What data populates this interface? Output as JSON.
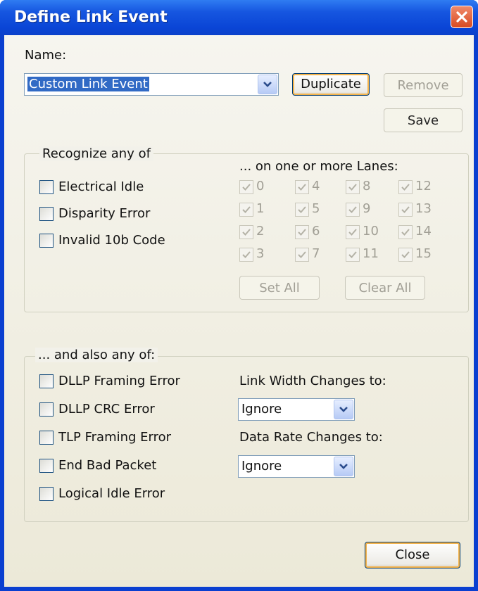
{
  "window": {
    "title": "Define Link Event"
  },
  "name_section": {
    "label": "Name:",
    "selected": "Custom Link Event",
    "duplicate_label": "Duplicate",
    "remove_label": "Remove",
    "save_label": "Save"
  },
  "recognize": {
    "title": "Recognize any of",
    "options": [
      "Electrical Idle",
      "Disparity Error",
      "Invalid 10b Code"
    ],
    "lanes_title": "... on one or more Lanes:",
    "lanes": [
      "0",
      "1",
      "2",
      "3",
      "4",
      "5",
      "6",
      "7",
      "8",
      "9",
      "10",
      "11",
      "12",
      "13",
      "14",
      "15"
    ],
    "set_all_label": "Set All",
    "clear_all_label": "Clear All"
  },
  "also": {
    "title": "... and also any of:",
    "options": [
      "DLLP Framing Error",
      "DLLP CRC Error",
      "TLP Framing Error",
      "End Bad Packet",
      "Logical Idle Error"
    ],
    "link_width_label": "Link Width Changes to:",
    "link_width_value": "Ignore",
    "data_rate_label": "Data Rate Changes to:",
    "data_rate_value": "Ignore"
  },
  "footer": {
    "close_label": "Close"
  },
  "icons": {
    "close": "close-icon",
    "dropdown": "chevron-down-icon",
    "check": "check-icon"
  },
  "colors": {
    "titlebar": "#0a45d6",
    "close_button": "#d84a22",
    "dialog_bg": "#ece9d8"
  }
}
